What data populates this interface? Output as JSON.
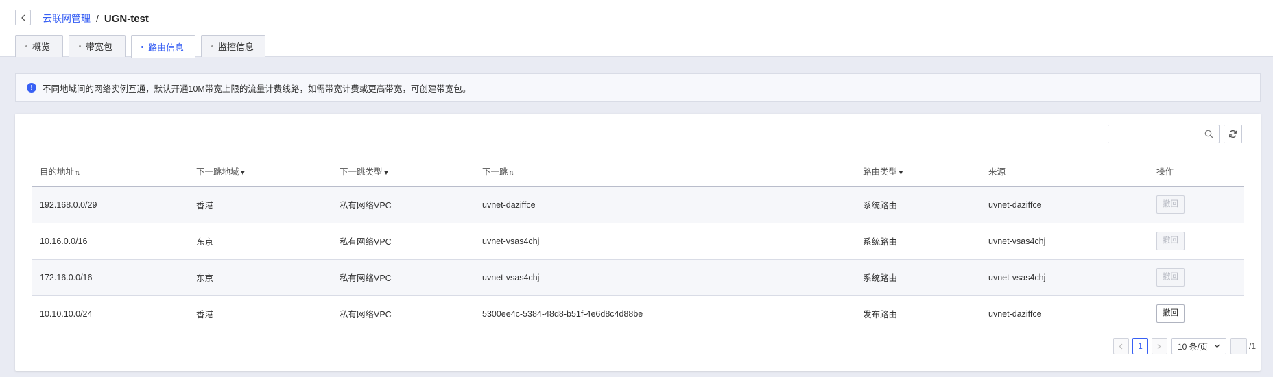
{
  "breadcrumb": {
    "parent": "云联网管理",
    "separator": "/",
    "current": "UGN-test"
  },
  "tabs": [
    {
      "label": "概览",
      "active": false
    },
    {
      "label": "带宽包",
      "active": false
    },
    {
      "label": "路由信息",
      "active": true
    },
    {
      "label": "监控信息",
      "active": false
    }
  ],
  "notice": {
    "icon": "info-icon",
    "text": "不同地域间的网络实例互通，默认开通10M带宽上限的流量计费线路，如需带宽计费或更高带宽，可创建带宽包。"
  },
  "search": {
    "placeholder": "",
    "value": ""
  },
  "table": {
    "headers": {
      "destination": "目的地址",
      "next_hop_region": "下一跳地域",
      "next_hop_type": "下一跳类型",
      "next_hop": "下一跳",
      "route_type": "路由类型",
      "source": "来源",
      "action": "操作"
    },
    "rows": [
      {
        "destination": "192.168.0.0/29",
        "next_hop_region": "香港",
        "next_hop_type": "私有网络VPC",
        "next_hop": "uvnet-daziffce",
        "route_type": "系统路由",
        "source": "uvnet-daziffce",
        "action": "撤回",
        "action_enabled": false
      },
      {
        "destination": "10.16.0.0/16",
        "next_hop_region": "东京",
        "next_hop_type": "私有网络VPC",
        "next_hop": "uvnet-vsas4chj",
        "route_type": "系统路由",
        "source": "uvnet-vsas4chj",
        "action": "撤回",
        "action_enabled": false
      },
      {
        "destination": "172.16.0.0/16",
        "next_hop_region": "东京",
        "next_hop_type": "私有网络VPC",
        "next_hop": "uvnet-vsas4chj",
        "route_type": "系统路由",
        "source": "uvnet-vsas4chj",
        "action": "撤回",
        "action_enabled": false
      },
      {
        "destination": "10.10.10.0/24",
        "next_hop_region": "香港",
        "next_hop_type": "私有网络VPC",
        "next_hop": "5300ee4c-5384-48d8-b51f-4e6d8c4d88be",
        "route_type": "发布路由",
        "source": "uvnet-daziffce",
        "action": "撤回",
        "action_enabled": true
      }
    ]
  },
  "pagination": {
    "current_page": "1",
    "page_size": "10 条/页",
    "total_pages": "/1"
  },
  "colors": {
    "accent": "#3860f4",
    "background": "#e9ebf3"
  }
}
